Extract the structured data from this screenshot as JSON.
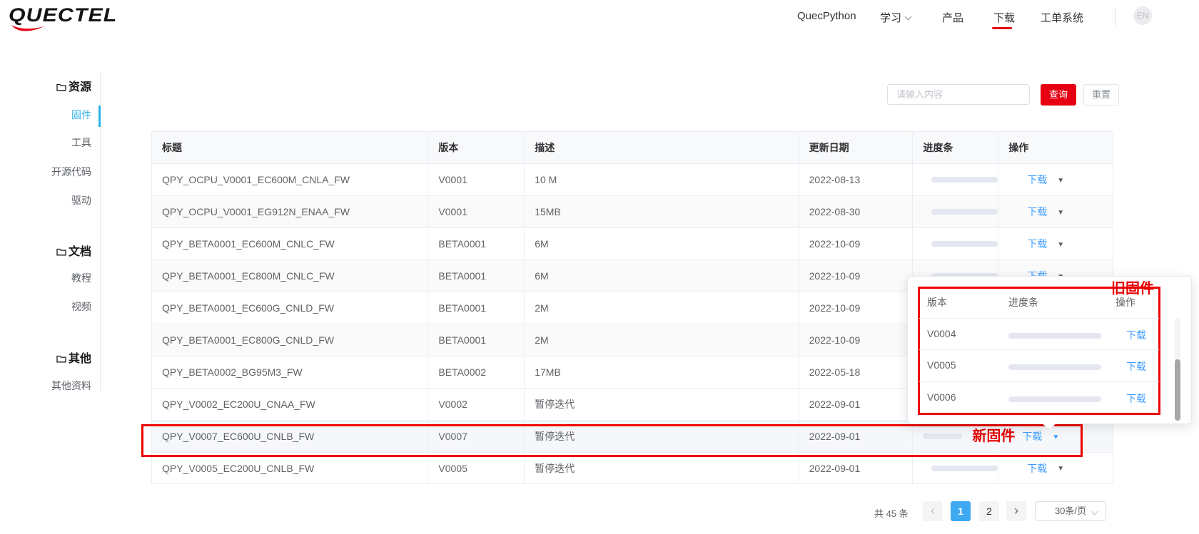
{
  "header": {
    "logo": "QUECTEL",
    "nav": [
      "QuecPython",
      "学习",
      "产品",
      "下载",
      "工单系统"
    ],
    "lang": "EN"
  },
  "sidebar": {
    "groups": [
      {
        "label": "资源",
        "items": [
          "固件",
          "工具",
          "开源代码",
          "驱动"
        ]
      },
      {
        "label": "文档",
        "items": [
          "教程",
          "视频"
        ]
      },
      {
        "label": "其他",
        "items": [
          "其他资料"
        ]
      }
    ],
    "active_item": "固件"
  },
  "toolbar": {
    "search_placeholder": "请输入内容",
    "query": "查询",
    "reset": "重置"
  },
  "table": {
    "columns": [
      "标题",
      "版本",
      "描述",
      "更新日期",
      "进度条",
      "操作"
    ],
    "download": "下载",
    "rows": [
      {
        "title": "QPY_OCPU_V0001_EC600M_CNLA_FW",
        "version": "V0001",
        "desc": "10 M",
        "date": "2022-08-13"
      },
      {
        "title": "QPY_OCPU_V0001_EG912N_ENAA_FW",
        "version": "V0001",
        "desc": "15MB",
        "date": "2022-08-30"
      },
      {
        "title": "QPY_BETA0001_EC600M_CNLC_FW",
        "version": "BETA0001",
        "desc": "6M",
        "date": "2022-10-09"
      },
      {
        "title": "QPY_BETA0001_EC800M_CNLC_FW",
        "version": "BETA0001",
        "desc": "6M",
        "date": "2022-10-09"
      },
      {
        "title": "QPY_BETA0001_EC600G_CNLD_FW",
        "version": "BETA0001",
        "desc": "2M",
        "date": "2022-10-09"
      },
      {
        "title": "QPY_BETA0001_EC800G_CNLD_FW",
        "version": "BETA0001",
        "desc": "2M",
        "date": "2022-10-09"
      },
      {
        "title": "QPY_BETA0002_BG95M3_FW",
        "version": "BETA0002",
        "desc": "17MB",
        "date": "2022-05-18"
      },
      {
        "title": "QPY_V0002_EC200U_CNAA_FW",
        "version": "V0002",
        "desc": "暂停迭代",
        "date": "2022-09-01"
      },
      {
        "title": "QPY_V0007_EC600U_CNLB_FW",
        "version": "V0007",
        "desc": "暂停迭代",
        "date": "2022-09-01"
      },
      {
        "title": "QPY_V0005_EC200U_CNLB_FW",
        "version": "V0005",
        "desc": "暂停迭代",
        "date": "2022-09-01"
      }
    ]
  },
  "annotations": {
    "new_firmware": "新固件",
    "old_firmware": "旧固件"
  },
  "popup": {
    "columns": [
      "版本",
      "进度条",
      "操作"
    ],
    "download": "下载",
    "rows": [
      {
        "version": "V0004"
      },
      {
        "version": "V0005"
      },
      {
        "version": "V0006"
      }
    ]
  },
  "pagination": {
    "total": "共 45 条",
    "prev": "‹",
    "next": "›",
    "pages": [
      "1",
      "2"
    ],
    "active": "1",
    "page_size": "30条/页"
  },
  "colors": {
    "brand_red": "#e60012",
    "annotation_red": "#ec0000",
    "link_blue": "#409eff",
    "sidebar_active_cyan": "#29b1e6",
    "page_active_blue": "#3ea8f0"
  }
}
